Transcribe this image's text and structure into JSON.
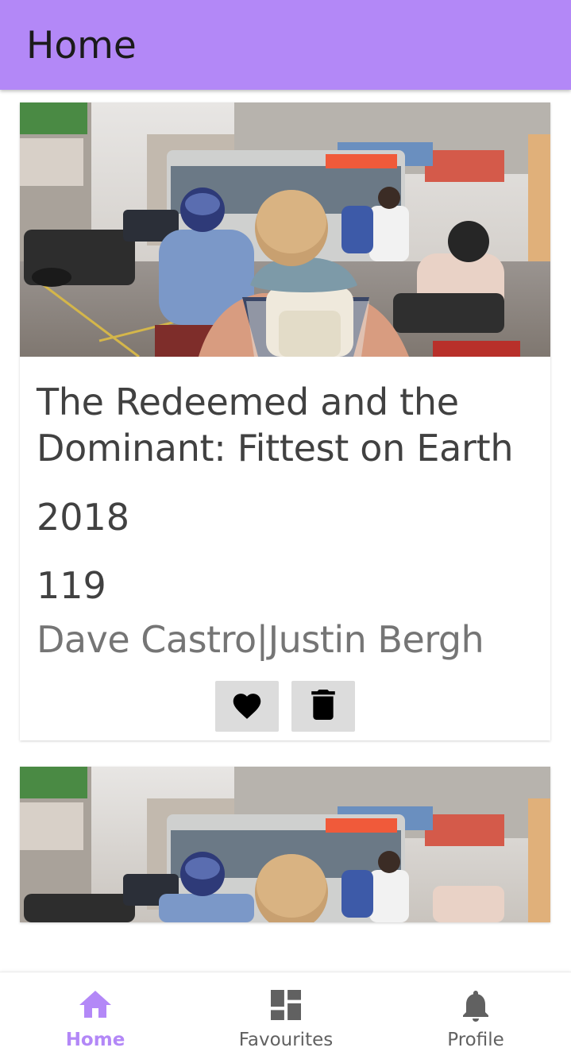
{
  "appbar": {
    "title": "Home",
    "color": "#b388f7"
  },
  "movies": [
    {
      "title": "The Redeemed and the Dominant: Fittest on Earth",
      "year": "2018",
      "runtime": "119",
      "directors": "Dave Castro|Justin Bergh",
      "image": "street-scene-photo"
    },
    {
      "image": "street-scene-photo"
    }
  ],
  "actions": {
    "favourite_icon": "heart-icon",
    "delete_icon": "trash-icon"
  },
  "nav": {
    "items": [
      {
        "label": "Home",
        "icon": "home-icon",
        "active": true
      },
      {
        "label": "Favourites",
        "icon": "dashboard-icon",
        "active": false
      },
      {
        "label": "Profile",
        "icon": "bell-icon",
        "active": false
      }
    ],
    "active_color": "#b388f7",
    "inactive_color": "#616161"
  }
}
